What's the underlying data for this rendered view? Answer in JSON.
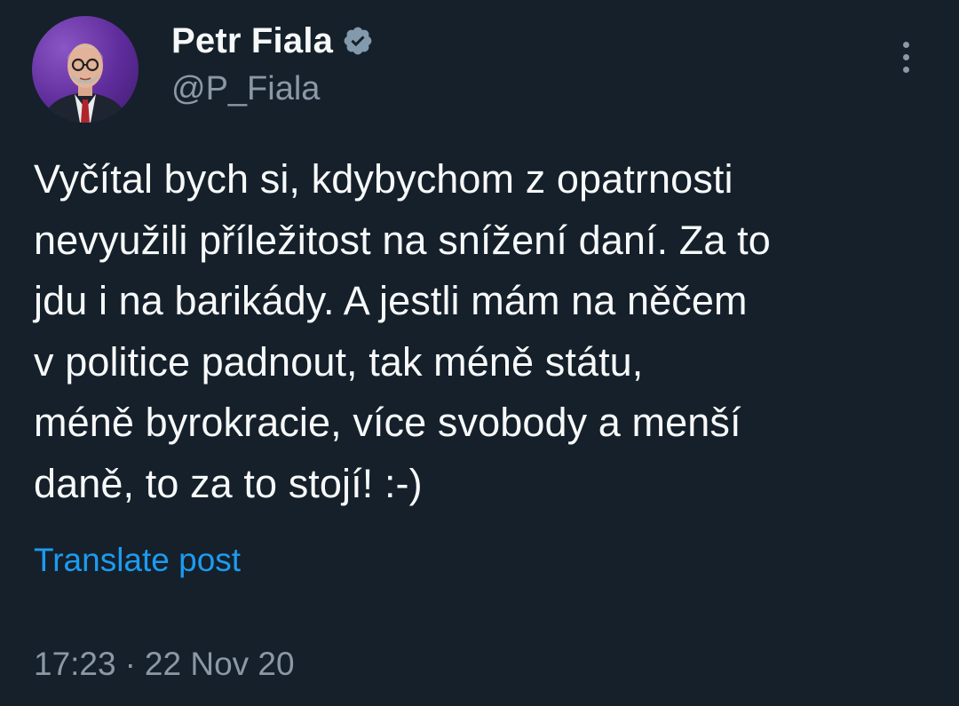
{
  "author": {
    "display_name": "Petr Fiala",
    "handle": "@P_Fiala",
    "verified_icon": "verified-badge-icon",
    "avatar_icon": "avatar"
  },
  "post": {
    "text": "Vyčítal bych si, kdybychom z opatrnosti\nnevyužili příležitost na snížení daní. Za to\njdu i na barikády. A jestli mám na něčem\nv politice padnout, tak méně státu,\nméně byrokracie, více svobody a menší\ndaně, to za to stojí! :-)",
    "translate_label": "Translate post",
    "time": "17:23",
    "separator": "·",
    "date": "22 Nov 20"
  },
  "menu": {
    "icon": "more-vertical-icon"
  },
  "colors": {
    "background": "#15202b",
    "text_primary": "#f7f9f9",
    "text_secondary": "#8b98a5",
    "link": "#1d9bf0",
    "avatar_bg": "#6a33a8"
  }
}
